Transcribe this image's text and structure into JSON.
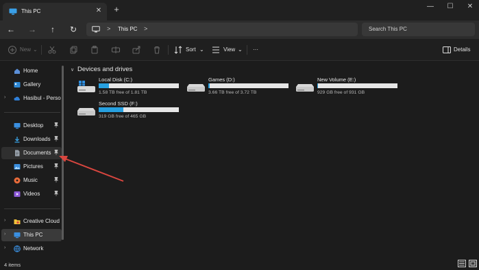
{
  "window": {
    "tab_title": "This PC",
    "tab_close": "✕",
    "new_tab": "+",
    "minimize": "—",
    "maximize": "☐",
    "close": "✕"
  },
  "navigation": {
    "back": "←",
    "forward": "→",
    "up": "↑",
    "refresh": "↻",
    "chevron": ">",
    "breadcrumb": "This PC",
    "search_placeholder": "Search This PC"
  },
  "commands": {
    "new": "New",
    "sort": "Sort",
    "view": "View",
    "more": "···",
    "details": "Details"
  },
  "sidebar": {
    "items": [
      {
        "label": "Home",
        "icon": "home-icon"
      },
      {
        "label": "Gallery",
        "icon": "gallery-icon"
      },
      {
        "label": "Hasibul - Personal",
        "icon": "cloud-icon"
      },
      {
        "label": "Desktop",
        "icon": "desktop-icon"
      },
      {
        "label": "Downloads",
        "icon": "download-icon"
      },
      {
        "label": "Documents",
        "icon": "document-icon"
      },
      {
        "label": "Pictures",
        "icon": "pictures-icon"
      },
      {
        "label": "Music",
        "icon": "music-icon"
      },
      {
        "label": "Videos",
        "icon": "videos-icon"
      },
      {
        "label": "Creative Cloud Files",
        "icon": "creative-cloud-icon"
      },
      {
        "label": "This PC",
        "icon": "pc-icon"
      },
      {
        "label": "Network",
        "icon": "network-icon"
      }
    ]
  },
  "content": {
    "section_title": "Devices and drives",
    "drives": [
      {
        "name": "Local Disk (C:)",
        "free": "1.58 TB free of 1.81 TB",
        "used_fraction": 0.13,
        "icon": "system-drive-icon"
      },
      {
        "name": "Games (D:)",
        "free": "3.66 TB free of 3.72 TB",
        "used_fraction": 0.02,
        "icon": "hard-drive-icon"
      },
      {
        "name": "New Volume (E:)",
        "free": "929 GB free of 931 GB",
        "used_fraction": 0.01,
        "icon": "hard-drive-icon"
      },
      {
        "name": "Second SSD (F:)",
        "free": "319 GB free of 465 GB",
        "used_fraction": 0.31,
        "icon": "hard-drive-icon"
      }
    ]
  },
  "status": {
    "items_count": "4 items"
  },
  "colors": {
    "accent": "#27a0e0",
    "annotation_arrow": "#d9463f"
  }
}
